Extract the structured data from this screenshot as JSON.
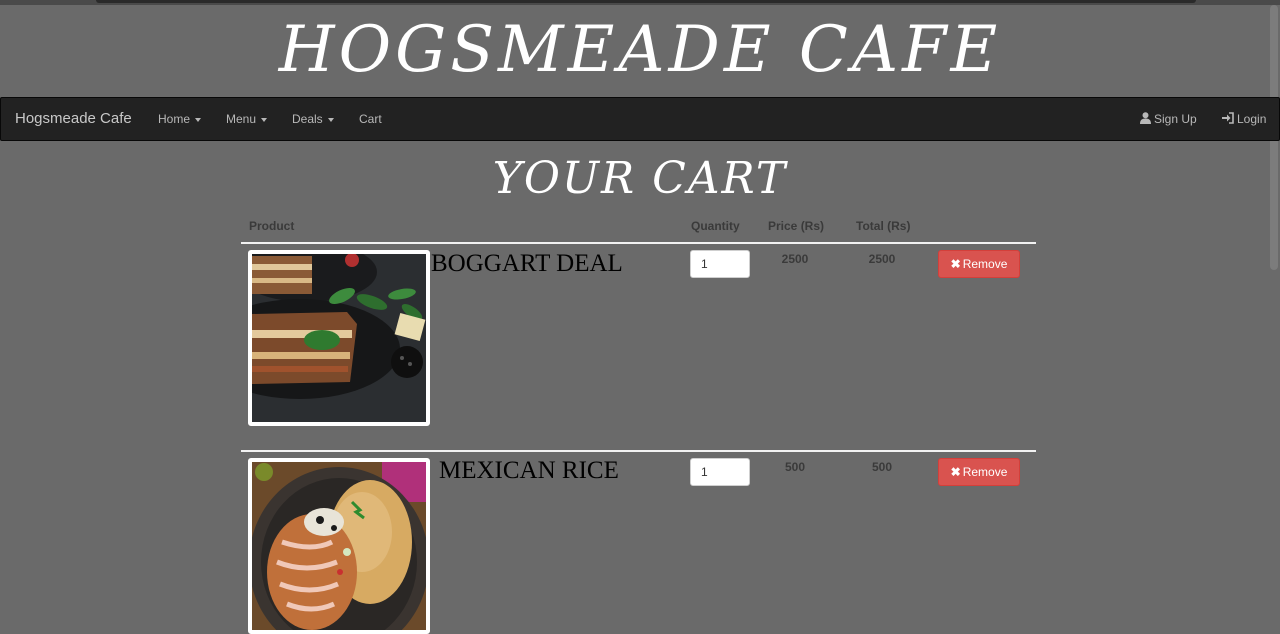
{
  "site": {
    "title": "HOGSMEADE CAFE"
  },
  "navbar": {
    "brand": "Hogsmeade Cafe",
    "items": [
      {
        "label": "Home",
        "dropdown": true
      },
      {
        "label": "Menu",
        "dropdown": true
      },
      {
        "label": "Deals",
        "dropdown": true
      },
      {
        "label": "Cart",
        "dropdown": false
      }
    ],
    "right": [
      {
        "label": "Sign Up",
        "icon": "user-icon"
      },
      {
        "label": "Login",
        "icon": "login-icon"
      }
    ]
  },
  "cart": {
    "heading": "YOUR CART",
    "columns": {
      "product": "Product",
      "quantity": "Quantity",
      "price": "Price (Rs)",
      "total": "Total (Rs)"
    },
    "items": [
      {
        "name": "BOGGART DEAL",
        "quantity": "1",
        "price": "2500",
        "total": "2500",
        "remove_label": "Remove"
      },
      {
        "name": "MEXICAN RICE",
        "quantity": "1",
        "price": "500",
        "total": "500",
        "remove_label": "Remove"
      }
    ]
  },
  "colors": {
    "background": "#6a6a6a",
    "navbar": "#222222",
    "remove_button": "#d9534f"
  }
}
